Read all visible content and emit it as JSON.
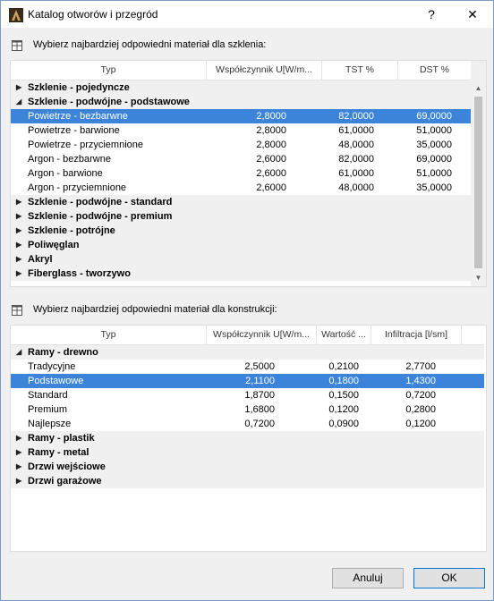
{
  "window": {
    "title": "Katalog otworów i przegród",
    "help_label": "?",
    "close_label": "✕"
  },
  "glazing": {
    "header": "Wybierz najbardziej odpowiedni materiał dla szklenia:",
    "columns": [
      "Typ",
      "Współczynnik U[W/m...",
      "TST %",
      "DST %"
    ],
    "rows": [
      {
        "type": "group",
        "expanded": false,
        "name": "Szklenie - pojedyncze"
      },
      {
        "type": "group",
        "expanded": true,
        "name": "Szklenie - podwójne - podstawowe"
      },
      {
        "type": "item",
        "selected": true,
        "name": "Powietrze - bezbarwne",
        "u": "2,8000",
        "tst": "82,0000",
        "dst": "69,0000"
      },
      {
        "type": "item",
        "name": "Powietrze - barwione",
        "u": "2,8000",
        "tst": "61,0000",
        "dst": "51,0000"
      },
      {
        "type": "item",
        "name": "Powietrze - przyciemnione",
        "u": "2,8000",
        "tst": "48,0000",
        "dst": "35,0000"
      },
      {
        "type": "item",
        "name": "Argon - bezbarwne",
        "u": "2,6000",
        "tst": "82,0000",
        "dst": "69,0000"
      },
      {
        "type": "item",
        "name": "Argon - barwione",
        "u": "2,6000",
        "tst": "61,0000",
        "dst": "51,0000"
      },
      {
        "type": "item",
        "name": "Argon - przyciemnione",
        "u": "2,6000",
        "tst": "48,0000",
        "dst": "35,0000"
      },
      {
        "type": "group",
        "expanded": false,
        "name": "Szklenie - podwójne - standard"
      },
      {
        "type": "group",
        "expanded": false,
        "name": "Szklenie - podwójne - premium"
      },
      {
        "type": "group",
        "expanded": false,
        "name": "Szklenie - potrójne"
      },
      {
        "type": "group",
        "expanded": false,
        "name": "Poliwęglan"
      },
      {
        "type": "group",
        "expanded": false,
        "name": "Akryl"
      },
      {
        "type": "group",
        "expanded": false,
        "name": "Fiberglass - tworzywo"
      }
    ]
  },
  "construction": {
    "header": "Wybierz najbardziej odpowiedni materiał dla konstrukcji:",
    "columns": [
      "Typ",
      "Współczynnik U[W/m...",
      "Wartość ...",
      "Infiltracja [l/sm]"
    ],
    "rows": [
      {
        "type": "group",
        "expanded": true,
        "name": "Ramy - drewno"
      },
      {
        "type": "item",
        "name": "Tradycyjne",
        "u": "2,5000",
        "val": "0,2100",
        "inf": "2,7700"
      },
      {
        "type": "item",
        "selected": true,
        "name": "Podstawowe",
        "u": "2,1100",
        "val": "0,1800",
        "inf": "1,4300"
      },
      {
        "type": "item",
        "name": "Standard",
        "u": "1,8700",
        "val": "0,1500",
        "inf": "0,7200"
      },
      {
        "type": "item",
        "name": "Premium",
        "u": "1,6800",
        "val": "0,1200",
        "inf": "0,2800"
      },
      {
        "type": "item",
        "name": "Najlepsze",
        "u": "0,7200",
        "val": "0,0900",
        "inf": "0,1200"
      },
      {
        "type": "group",
        "expanded": false,
        "name": "Ramy - plastik"
      },
      {
        "type": "group",
        "expanded": false,
        "name": "Ramy - metal"
      },
      {
        "type": "group",
        "expanded": false,
        "name": "Drzwi wejściowe"
      },
      {
        "type": "group",
        "expanded": false,
        "name": "Drzwi garażowe"
      }
    ]
  },
  "buttons": {
    "cancel": "Anuluj",
    "ok": "OK"
  },
  "colors": {
    "selection": "#3b84d9",
    "group_bg": "#f0f0f0",
    "ok_border": "#0078d7"
  }
}
